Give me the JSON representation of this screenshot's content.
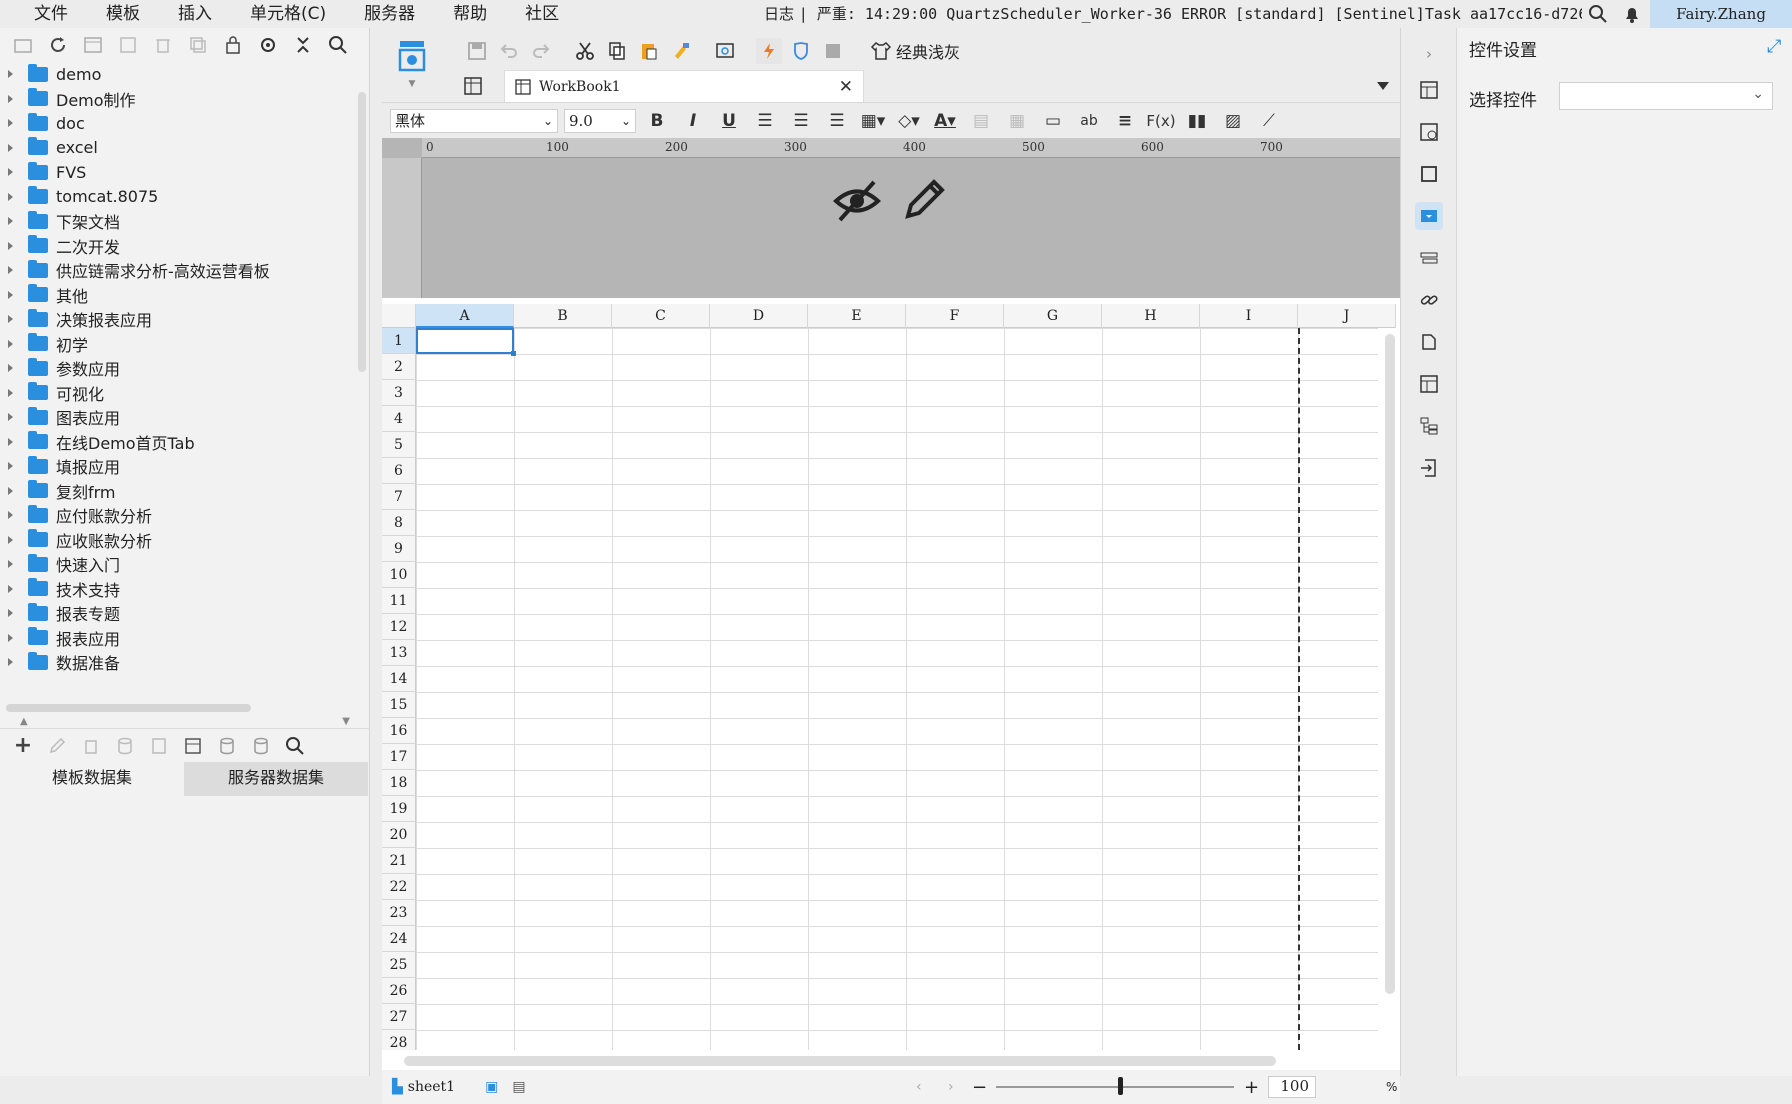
{
  "menubar": {
    "items": [
      "文件",
      "模板",
      "插入",
      "单元格(C)",
      "服务器",
      "帮助",
      "社区"
    ],
    "log_label": "日志",
    "log_text": "| 严重: 14:29:00 QuartzScheduler_Worker-36 ERROR [standard] [Sentinel]Task aa17cc16-d726-4c1a...",
    "user": "Fairy.Zhang"
  },
  "tree": {
    "items": [
      "demo",
      "Demo制作",
      "doc",
      "excel",
      "FVS",
      "tomcat.8075",
      "下架文档",
      "二次开发",
      "供应链需求分析-高效运营看板",
      "其他",
      "决策报表应用",
      "初学",
      "参数应用",
      "可视化",
      "图表应用",
      "在线Demo首页Tab",
      "填报应用",
      "复刻frm",
      "应付账款分析",
      "应收账款分析",
      "快速入门",
      "技术支持",
      "报表专题",
      "报表应用",
      "数据准备"
    ]
  },
  "dataset_tabs": [
    "模板数据集",
    "服务器数据集"
  ],
  "toolbar": {
    "theme_label": "经典浅灰",
    "document_tab": "WorkBook1",
    "font": "黑体",
    "font_size": "9.0"
  },
  "ruler": {
    "labels": [
      "0",
      "100",
      "200",
      "300",
      "400",
      "500",
      "600",
      "700"
    ]
  },
  "sheet": {
    "columns": [
      "A",
      "B",
      "C",
      "D",
      "E",
      "F",
      "G",
      "H",
      "I",
      "J"
    ],
    "rows": [
      "1",
      "2",
      "3",
      "4",
      "5",
      "6",
      "7",
      "8",
      "9",
      "10",
      "11",
      "12",
      "13",
      "14",
      "15",
      "16",
      "17",
      "18",
      "19",
      "20",
      "21",
      "22",
      "23",
      "24",
      "25",
      "26",
      "27",
      "28"
    ],
    "selected": "A1"
  },
  "status": {
    "sheet_name": "sheet1",
    "zoom": "100",
    "zoom_unit": "%"
  },
  "settings": {
    "title": "控件设置",
    "select_label": "选择控件",
    "select_value": ""
  }
}
